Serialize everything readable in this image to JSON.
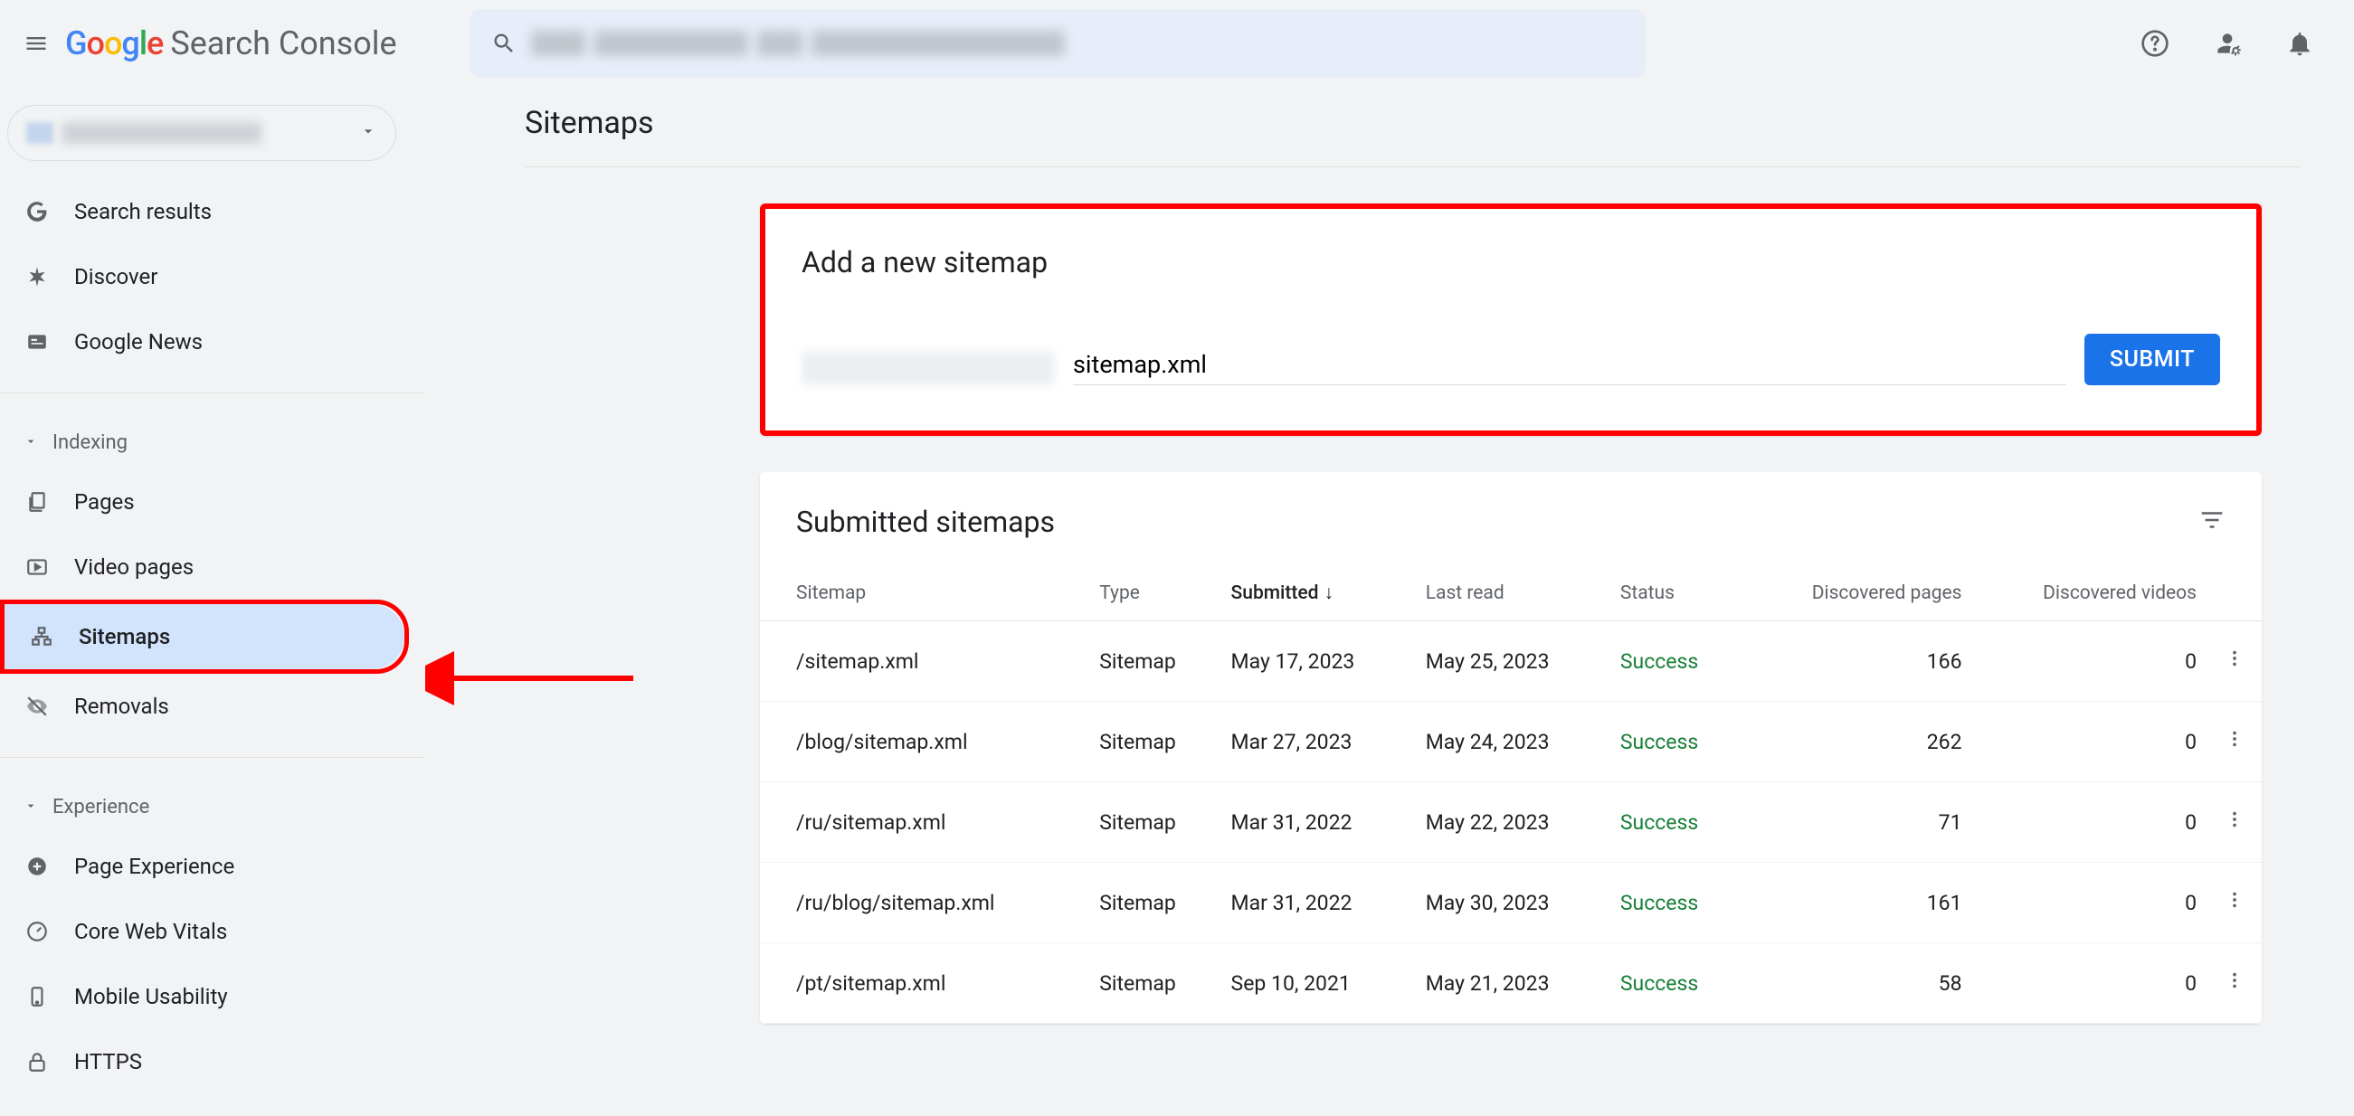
{
  "header": {
    "logo_text": "Search Console"
  },
  "sidebar": {
    "items": [
      {
        "label": "Search results"
      },
      {
        "label": "Discover"
      },
      {
        "label": "Google News"
      }
    ],
    "section_indexing": "Indexing",
    "indexing_items": [
      {
        "label": "Pages"
      },
      {
        "label": "Video pages"
      },
      {
        "label": "Sitemaps"
      },
      {
        "label": "Removals"
      }
    ],
    "section_experience": "Experience",
    "experience_items": [
      {
        "label": "Page Experience"
      },
      {
        "label": "Core Web Vitals"
      },
      {
        "label": "Mobile Usability"
      },
      {
        "label": "HTTPS"
      }
    ]
  },
  "page": {
    "title": "Sitemaps",
    "add_title": "Add a new sitemap",
    "sitemap_input_value": "sitemap.xml",
    "submit_label": "SUBMIT",
    "submitted_title": "Submitted sitemaps",
    "columns": {
      "sitemap": "Sitemap",
      "type": "Type",
      "submitted": "Submitted",
      "last_read": "Last read",
      "status": "Status",
      "disc_pages": "Discovered pages",
      "disc_videos": "Discovered videos"
    },
    "rows": [
      {
        "sitemap": "/sitemap.xml",
        "type": "Sitemap",
        "submitted": "May 17, 2023",
        "last_read": "May 25, 2023",
        "status": "Success",
        "pages": "166",
        "videos": "0"
      },
      {
        "sitemap": "/blog/sitemap.xml",
        "type": "Sitemap",
        "submitted": "Mar 27, 2023",
        "last_read": "May 24, 2023",
        "status": "Success",
        "pages": "262",
        "videos": "0"
      },
      {
        "sitemap": "/ru/sitemap.xml",
        "type": "Sitemap",
        "submitted": "Mar 31, 2022",
        "last_read": "May 22, 2023",
        "status": "Success",
        "pages": "71",
        "videos": "0"
      },
      {
        "sitemap": "/ru/blog/sitemap.xml",
        "type": "Sitemap",
        "submitted": "Mar 31, 2022",
        "last_read": "May 30, 2023",
        "status": "Success",
        "pages": "161",
        "videos": "0"
      },
      {
        "sitemap": "/pt/sitemap.xml",
        "type": "Sitemap",
        "submitted": "Sep 10, 2021",
        "last_read": "May 21, 2023",
        "status": "Success",
        "pages": "58",
        "videos": "0"
      }
    ]
  }
}
